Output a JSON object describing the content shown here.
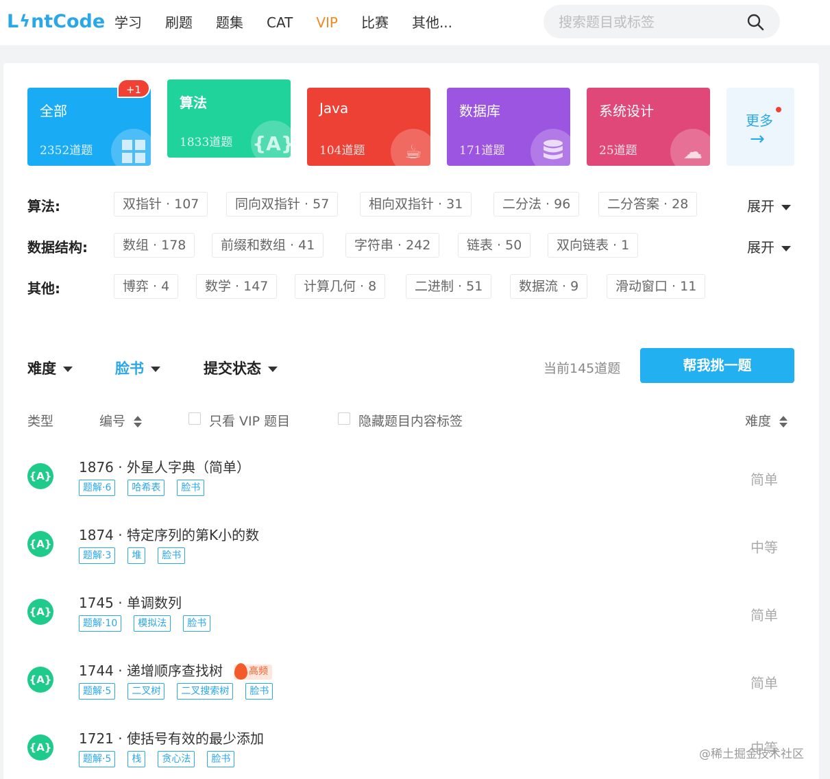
{
  "brand": {
    "logo_text_pre": "L",
    "logo_text_post": "ntCode"
  },
  "nav": {
    "items": [
      "学习",
      "刷题",
      "题集",
      "CAT",
      "VIP",
      "比赛",
      "其他..."
    ]
  },
  "search": {
    "placeholder": "搜索题目或标签"
  },
  "categories": [
    {
      "name": "全部",
      "count": "2352道题",
      "icon": "grid-icon",
      "color": "#1aabf5"
    },
    {
      "name": "算法",
      "count": "1833道题",
      "icon": "algorithm-icon",
      "color": "#1fd39a"
    },
    {
      "name": "Java",
      "count": "104道题",
      "icon": "java-icon",
      "color": "#ee4135"
    },
    {
      "name": "数据库",
      "count": "171道题",
      "icon": "database-icon",
      "color": "#9b55e0"
    },
    {
      "name": "系统设计",
      "count": "25道题",
      "icon": "cloud-icon",
      "color": "#e0487a"
    }
  ],
  "new_badge": "+1",
  "more": {
    "label": "更多",
    "arrow": "→"
  },
  "tag_rows": {
    "algorithm": {
      "label": "算法:",
      "chips": [
        "双指针 · 107",
        "同向双指针 · 57",
        "相向双指针 · 31",
        "二分法 · 96",
        "二分答案 · 28"
      ],
      "expand": "展开"
    },
    "ds": {
      "label": "数据结构:",
      "chips": [
        "数组 · 178",
        "前缀和数组 · 41",
        "字符串 · 242",
        "链表 · 50",
        "双向链表 · 1"
      ],
      "expand": "展开"
    },
    "other": {
      "label": "其他:",
      "chips": [
        "博弈 · 4",
        "数学 · 147",
        "计算几何 · 8",
        "二进制 · 51",
        "数据流 · 9",
        "滑动窗口 · 11"
      ]
    }
  },
  "filters": {
    "difficulty": "难度",
    "company": "脸书",
    "status": "提交状态"
  },
  "count_text": "当前145道题",
  "pick_button": "帮我挑一题",
  "table_header": {
    "type": "类型",
    "id": "编号",
    "vip_only": "只看 VIP 题目",
    "hide_tags": "隐藏题目内容标签",
    "difficulty": "难度"
  },
  "problems": [
    {
      "type": "{A}",
      "title": "1876 · 外星人字典（简单）",
      "tags": [
        "题解·6",
        "哈希表",
        "脸书"
      ],
      "difficulty": "简单",
      "hot": ""
    },
    {
      "type": "{A}",
      "title": "1874 · 特定序列的第K小的数",
      "tags": [
        "题解·3",
        "堆",
        "脸书"
      ],
      "difficulty": "中等",
      "hot": ""
    },
    {
      "type": "{A}",
      "title": "1745 · 单调数列",
      "tags": [
        "题解·10",
        "模拟法",
        "脸书"
      ],
      "difficulty": "简单",
      "hot": ""
    },
    {
      "type": "{A}",
      "title": "1744 · 递增顺序查找树",
      "tags": [
        "题解·5",
        "二叉树",
        "二叉搜索树",
        "脸书"
      ],
      "difficulty": "简单",
      "hot": "高频"
    },
    {
      "type": "{A}",
      "title": "1721 · 使括号有效的最少添加",
      "tags": [
        "题解·5",
        "栈",
        "贪心法",
        "脸书"
      ],
      "difficulty": "中等",
      "hot": ""
    }
  ],
  "watermark": "@稀土掘金技术社区",
  "colors": {
    "accent": "#2aa7e8",
    "vip": "#f08a24",
    "button": "#22b0f0"
  }
}
